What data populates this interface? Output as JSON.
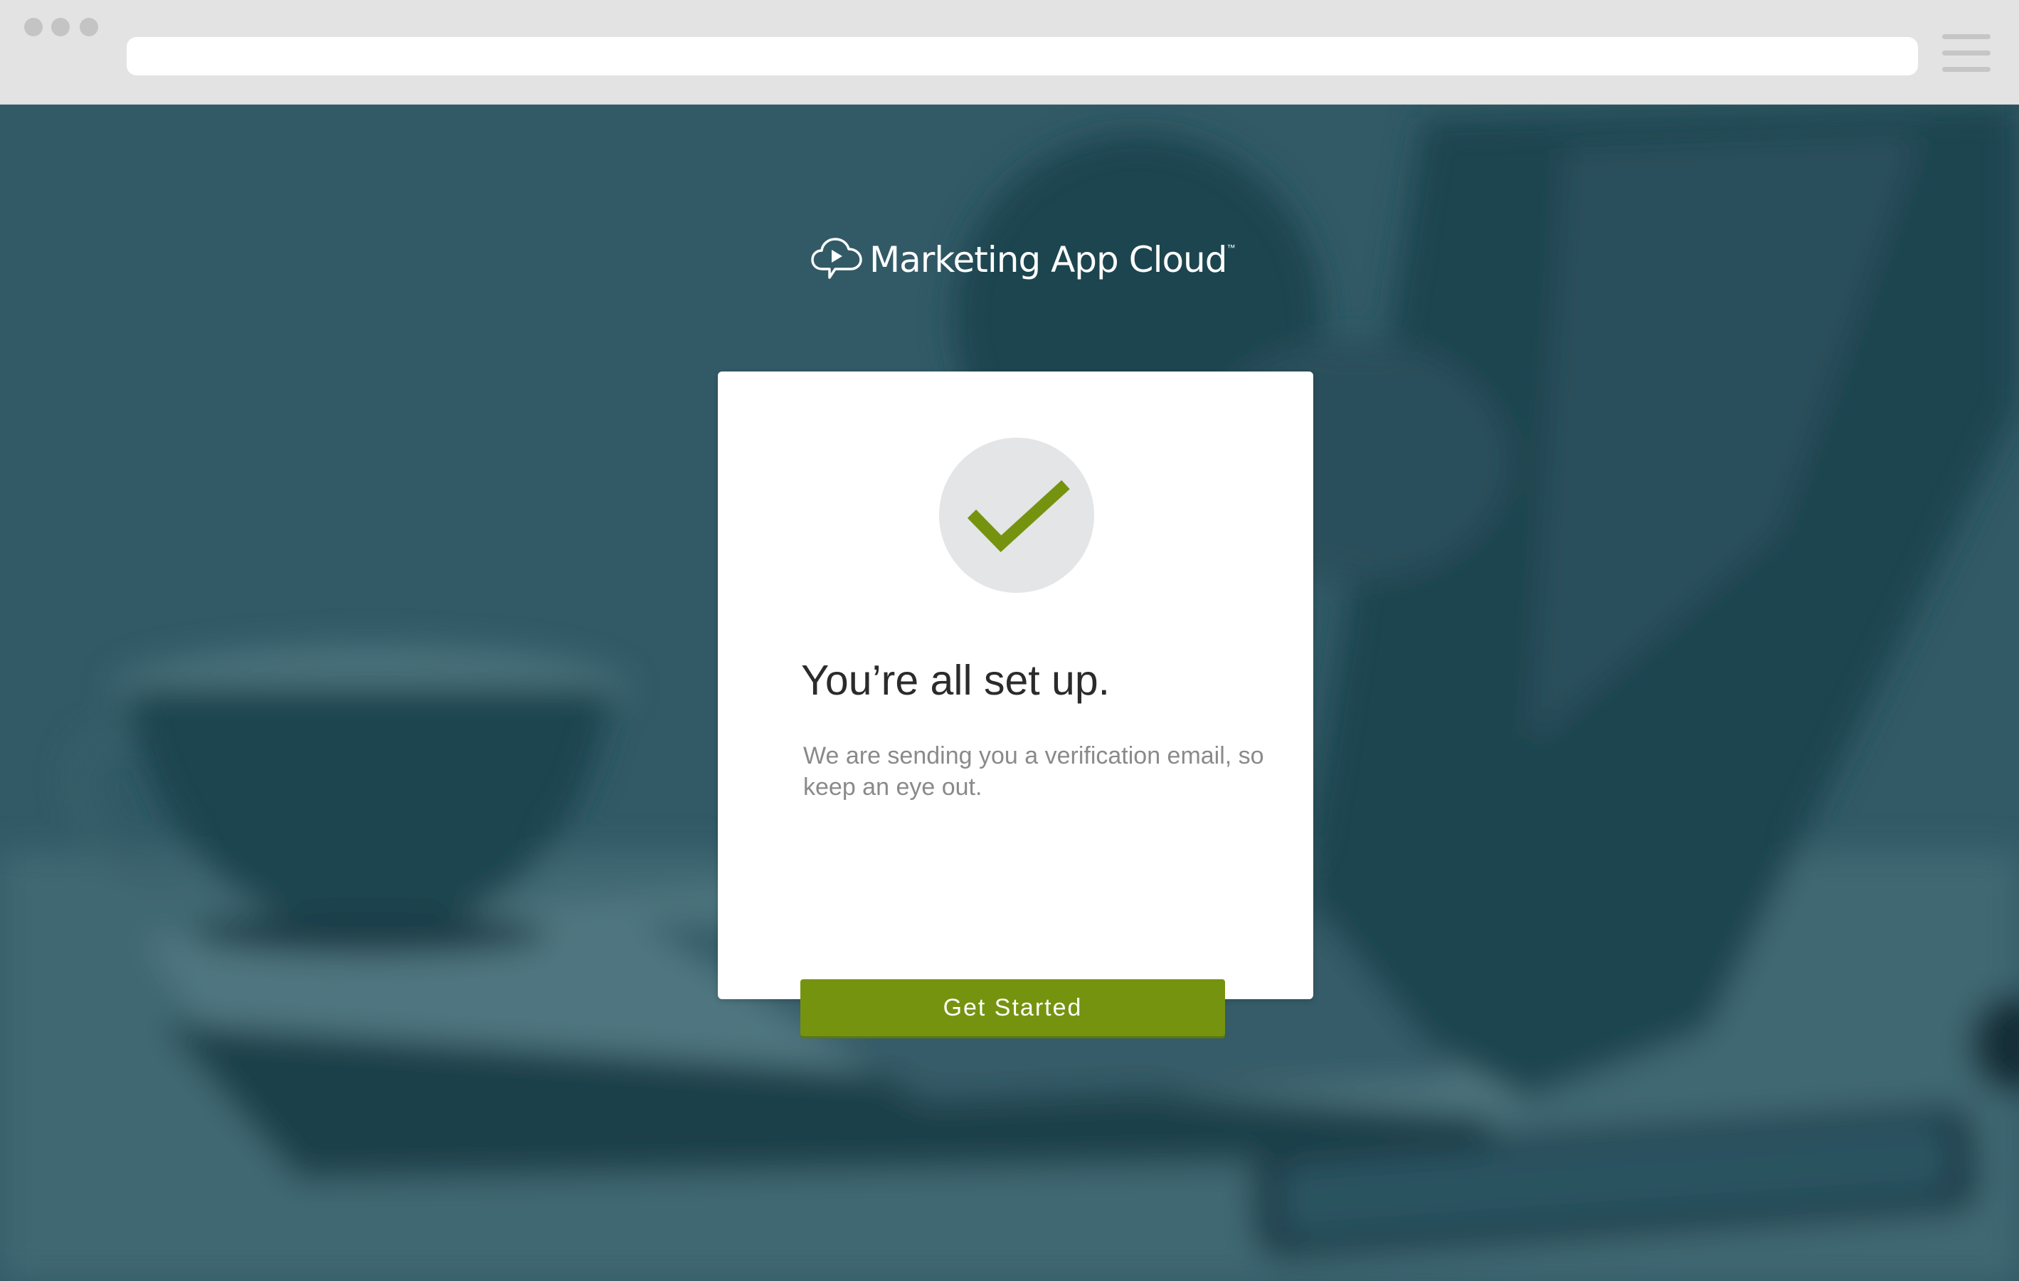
{
  "browser": {
    "url": ""
  },
  "brand": {
    "name": "Marketing App Cloud",
    "trademark": "™"
  },
  "confirmation": {
    "headline": "You’re all set up.",
    "message": "We are sending you a verification email, so keep an eye out.",
    "button_label": "Get Started"
  },
  "icons": {
    "logo": "cloud-play-icon",
    "status": "checkmark-icon",
    "menu": "hamburger-menu-icon"
  },
  "colors": {
    "accent": "#76930f",
    "overlay": "#2f5763",
    "card": "#ffffff",
    "chrome": "#e3e3e3"
  }
}
